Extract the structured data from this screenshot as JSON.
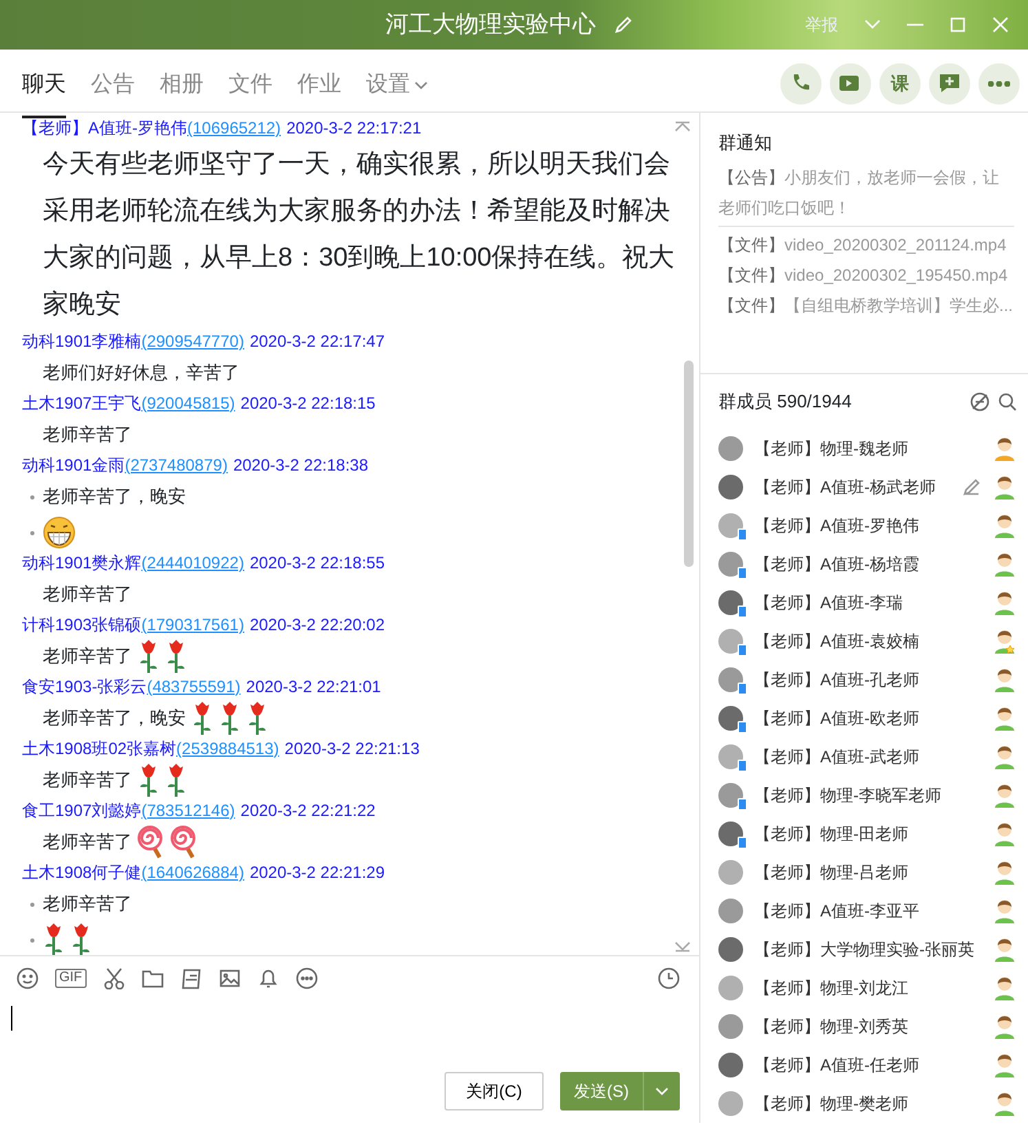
{
  "window": {
    "title": "河工大物理实验中心",
    "report": "举报"
  },
  "tabs": [
    {
      "label": "聊天",
      "selected": true,
      "dropdown": false
    },
    {
      "label": "公告",
      "selected": false,
      "dropdown": false
    },
    {
      "label": "相册",
      "selected": false,
      "dropdown": false
    },
    {
      "label": "文件",
      "selected": false,
      "dropdown": false
    },
    {
      "label": "作业",
      "selected": false,
      "dropdown": false
    },
    {
      "label": "设置",
      "selected": false,
      "dropdown": true
    }
  ],
  "actions": [
    {
      "kind": "phone"
    },
    {
      "kind": "video"
    },
    {
      "kind": "text",
      "label": "课"
    },
    {
      "kind": "comment"
    },
    {
      "kind": "more"
    }
  ],
  "messages": [
    {
      "sender": "【老师】A值班-罗艳伟",
      "qq": "(106965212)",
      "time": "2020-3-2 22:17:21",
      "large": true,
      "parts": [
        {
          "text": "今天有些老师坚守了一天，确实很累，所以明天我们会采用老师轮流在线为大家服务的办法！希望能及时解决大家的问题，从早上8：30到晚上10:00保持在线。祝大家晚安"
        }
      ]
    },
    {
      "sender": "动科1901李雅楠",
      "qq": "(2909547770)",
      "time": "2020-3-2 22:17:47",
      "large": false,
      "parts": [
        {
          "text": "老师们好好休息，辛苦了"
        }
      ]
    },
    {
      "sender": "土木1907王宇飞",
      "qq": "(920045815)",
      "time": "2020-3-2 22:18:15",
      "large": false,
      "parts": [
        {
          "text": "老师辛苦了"
        }
      ]
    },
    {
      "sender": "动科1901金雨",
      "qq": "(2737480879)",
      "time": "2020-3-2 22:18:38",
      "large": false,
      "parts": [
        {
          "text": "老师辛苦了，晚安"
        },
        {
          "stickers": [
            {
              "kind": "grin"
            }
          ]
        }
      ]
    },
    {
      "sender": "动科1901樊永辉",
      "qq": "(2444010922)",
      "time": "2020-3-2 22:18:55",
      "large": false,
      "parts": [
        {
          "text": "老师辛苦了"
        }
      ]
    },
    {
      "sender": "计科1903张锦硕",
      "qq": "(1790317561)",
      "time": "2020-3-2 22:20:02",
      "large": false,
      "parts": [
        {
          "text": "老师辛苦了",
          "stickers": [
            {
              "kind": "rose"
            },
            {
              "kind": "rose"
            }
          ]
        }
      ]
    },
    {
      "sender": "食安1903-张彩云",
      "qq": "(483755591)",
      "time": "2020-3-2 22:21:01",
      "large": false,
      "parts": [
        {
          "text": "老师辛苦了，晚安",
          "stickers": [
            {
              "kind": "rose"
            },
            {
              "kind": "rose"
            },
            {
              "kind": "rose"
            }
          ]
        }
      ]
    },
    {
      "sender": "土木1908班02张嘉树",
      "qq": "(2539884513)",
      "time": "2020-3-2 22:21:13",
      "large": false,
      "parts": [
        {
          "text": "老师辛苦了",
          "stickers": [
            {
              "kind": "rose"
            },
            {
              "kind": "rose"
            }
          ]
        }
      ]
    },
    {
      "sender": "食工1907刘懿婷",
      "qq": "(783512146)",
      "time": "2020-3-2 22:21:22",
      "large": false,
      "parts": [
        {
          "text": "老师辛苦了",
          "stickers": [
            {
              "kind": "lollipop"
            },
            {
              "kind": "lollipop"
            }
          ]
        }
      ]
    },
    {
      "sender": "土木1908何子健",
      "qq": "(1640626884)",
      "time": "2020-3-2 22:21:29",
      "large": false,
      "parts": [
        {
          "text": "老师辛苦了"
        },
        {
          "stickers": [
            {
              "kind": "rose"
            },
            {
              "kind": "rose"
            }
          ]
        }
      ]
    }
  ],
  "toolbar": [
    {
      "kind": "emoji"
    },
    {
      "kind": "gif",
      "label": "GIF"
    },
    {
      "kind": "scissors"
    },
    {
      "kind": "folder"
    },
    {
      "kind": "screenshot"
    },
    {
      "kind": "image"
    },
    {
      "kind": "bell"
    },
    {
      "kind": "more"
    }
  ],
  "buttons": {
    "close": "关闭(C)",
    "send": "发送(S)"
  },
  "notices": {
    "title": "群通知",
    "items": [
      {
        "tag": "【公告】",
        "text": "小朋友们，放老师一会假，让老师们吃口饭吧！"
      },
      {
        "tag": "【文件】",
        "text": "video_20200302_201124.mp4"
      },
      {
        "tag": "【文件】",
        "text": "video_20200302_195450.mp4"
      },
      {
        "tag": "【文件】",
        "text": "【自组电桥教学培训】学生必..."
      }
    ]
  },
  "members": {
    "title": "群成员 590/1944",
    "items": [
      {
        "name": "【老师】物理-魏老师",
        "mobile": false,
        "kind": "owner",
        "hovered": false
      },
      {
        "name": "【老师】A值班-杨武老师",
        "mobile": false,
        "kind": "member",
        "hovered": true
      },
      {
        "name": "【老师】A值班-罗艳伟",
        "mobile": true,
        "kind": "member",
        "hovered": false
      },
      {
        "name": "【老师】A值班-杨培霞",
        "mobile": true,
        "kind": "member",
        "hovered": false
      },
      {
        "name": "【老师】A值班-李瑞",
        "mobile": true,
        "kind": "member",
        "hovered": false
      },
      {
        "name": "【老师】A值班-袁姣楠",
        "mobile": true,
        "kind": "admin",
        "hovered": false
      },
      {
        "name": "【老师】A值班-孔老师",
        "mobile": true,
        "kind": "member",
        "hovered": false
      },
      {
        "name": "【老师】A值班-欧老师",
        "mobile": true,
        "kind": "member",
        "hovered": false
      },
      {
        "name": "【老师】A值班-武老师",
        "mobile": true,
        "kind": "member",
        "hovered": false
      },
      {
        "name": "【老师】物理-李晓军老师",
        "mobile": true,
        "kind": "member",
        "hovered": false
      },
      {
        "name": "【老师】物理-田老师",
        "mobile": true,
        "kind": "member",
        "hovered": false
      },
      {
        "name": "【老师】物理-吕老师",
        "mobile": false,
        "kind": "member",
        "hovered": false
      },
      {
        "name": "【老师】A值班-李亚平",
        "mobile": false,
        "kind": "member",
        "hovered": false
      },
      {
        "name": "【老师】大学物理实验-张丽英",
        "mobile": false,
        "kind": "member",
        "hovered": false
      },
      {
        "name": "【老师】物理-刘龙江",
        "mobile": false,
        "kind": "member",
        "hovered": false
      },
      {
        "name": "【老师】物理-刘秀英",
        "mobile": false,
        "kind": "member",
        "hovered": false
      },
      {
        "name": "【老师】A值班-任老师",
        "mobile": false,
        "kind": "member",
        "hovered": false
      },
      {
        "name": "【老师】物理-樊老师",
        "mobile": false,
        "kind": "member",
        "hovered": false
      }
    ]
  }
}
